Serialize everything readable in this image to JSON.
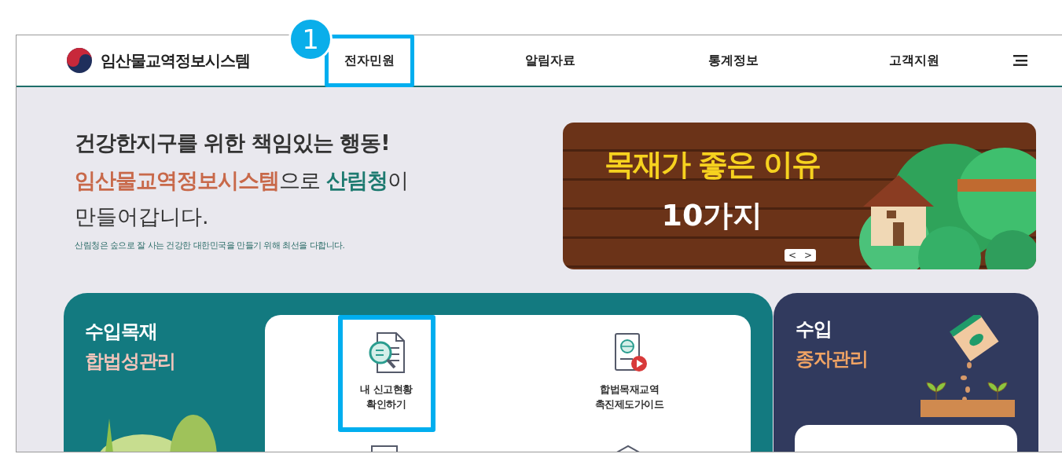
{
  "header": {
    "logo_text": "임산물교역정보시스템",
    "nav": [
      {
        "label": "전자민원",
        "highlighted": true,
        "annotation": "1"
      },
      {
        "label": "알림자료",
        "highlighted": false
      },
      {
        "label": "통계정보",
        "highlighted": false
      },
      {
        "label": "고객지원",
        "highlighted": false
      }
    ]
  },
  "hero": {
    "headline": "건강한지구를 위한 책임있는 행동!",
    "line2": [
      {
        "text": "임산물교역정보시스템",
        "kind": "accent"
      },
      {
        "text": "으로 ",
        "kind": "plain"
      },
      {
        "text": "산림청",
        "kind": "brand"
      },
      {
        "text": "이",
        "kind": "plain"
      }
    ],
    "line3": "만들어갑니다.",
    "subtitle": "산림청은 숲으로 잘 사는 건강한 대한민국을 만들기 위해 최선을 다합니다."
  },
  "banner": {
    "title": "목재가 좋은 이유",
    "subtitle": "10가지",
    "prev": "<",
    "next": ">"
  },
  "cards": [
    {
      "kind": "legality",
      "title": "수입목재",
      "subtitle": "합법성관리",
      "tiles": [
        {
          "kind": "report",
          "label": "내 신고현황\n확인하기",
          "highlighted": true
        },
        {
          "kind": "guide",
          "label": "합법목재교역\n촉진제도가이드",
          "highlighted": false
        }
      ]
    },
    {
      "kind": "seed",
      "title": "수입",
      "subtitle": "종자관리"
    }
  ]
}
